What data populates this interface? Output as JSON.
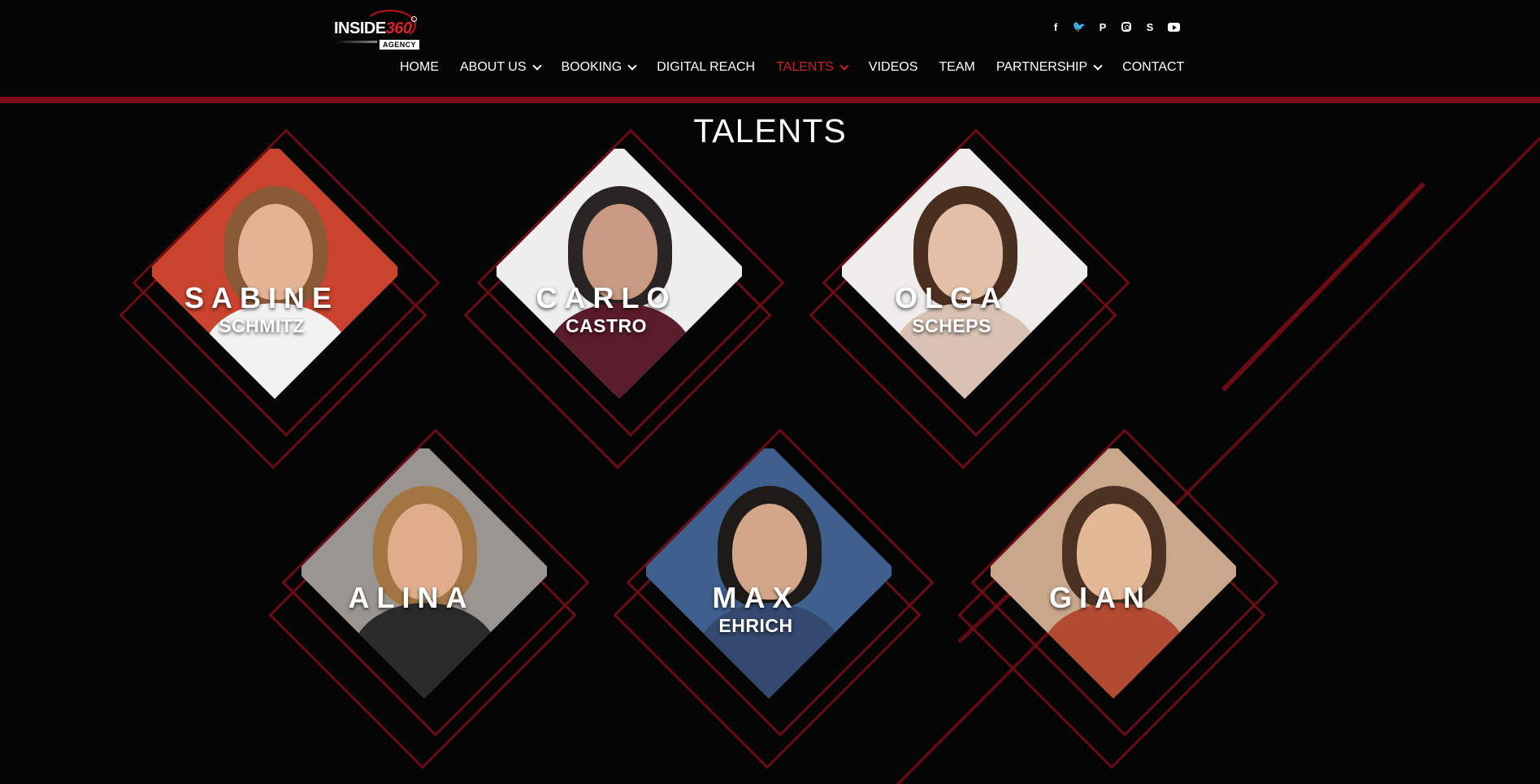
{
  "header": {
    "logo": {
      "word": "INSIDE",
      "number": "360",
      "tag": "AGENCY"
    },
    "social": [
      {
        "icon": "facebook-icon",
        "glyph": "f"
      },
      {
        "icon": "twitter-icon",
        "glyph": "🐦"
      },
      {
        "icon": "pinterest-icon",
        "glyph": "P"
      },
      {
        "icon": "instagram-icon",
        "glyph": ""
      },
      {
        "icon": "skype-icon",
        "glyph": "S"
      },
      {
        "icon": "youtube-icon",
        "glyph": ""
      }
    ],
    "nav": [
      {
        "label": "HOME",
        "dropdown": false,
        "active": false
      },
      {
        "label": "ABOUT US",
        "dropdown": true,
        "active": false
      },
      {
        "label": "BOOKING",
        "dropdown": true,
        "active": false
      },
      {
        "label": "DIGITAL REACH",
        "dropdown": false,
        "active": false
      },
      {
        "label": "TALENTS",
        "dropdown": true,
        "active": true
      },
      {
        "label": "VIDEOS",
        "dropdown": false,
        "active": false
      },
      {
        "label": "TEAM",
        "dropdown": false,
        "active": false
      },
      {
        "label": "PARTNERSHIP",
        "dropdown": true,
        "active": false
      },
      {
        "label": "CONTACT",
        "dropdown": false,
        "active": false
      }
    ]
  },
  "main": {
    "title": "TALENTS",
    "talents": [
      {
        "first": "SABINE",
        "last": "SCHMITZ",
        "bg": "#c9432e",
        "skin": "#e4b394",
        "hair": "#8a5a36",
        "outfit": "#f2f2f2"
      },
      {
        "first": "CARLO",
        "last": "CASTRO",
        "bg": "#eeeeee",
        "skin": "#c99a82",
        "hair": "#2b2424",
        "outfit": "#5a1b2a"
      },
      {
        "first": "OLGA",
        "last": "SCHEPS",
        "bg": "#efedeb",
        "skin": "#e2bfa6",
        "hair": "#4a2f20",
        "outfit": "#d9c2b3"
      },
      {
        "first": "ALINA",
        "last": "",
        "bg": "#9a9590",
        "skin": "#e0ad8c",
        "hair": "#a27543",
        "outfit": "#2a2a2a"
      },
      {
        "first": "MAX",
        "last": "EHRICH",
        "bg": "#3f5f8f",
        "skin": "#d4a689",
        "hair": "#1e1a18",
        "outfit": "#34496e"
      },
      {
        "first": "GIAN",
        "last": "",
        "bg": "#c8a78a",
        "skin": "#e3b896",
        "hair": "#4b3222",
        "outfit": "#b24b32"
      }
    ]
  }
}
